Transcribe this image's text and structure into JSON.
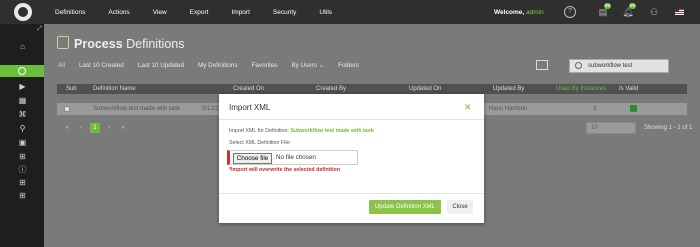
{
  "header": {
    "menu": [
      "Definitions",
      "Actions",
      "View",
      "Export",
      "Import",
      "Security",
      "Utils"
    ],
    "welcome_prefix": "Welcome,",
    "username": "admin",
    "notif_badge_1": "99",
    "notif_badge_2": "99"
  },
  "sidebar": {
    "icons": [
      "expand-icon",
      "home-icon",
      "process-icon",
      "play-icon",
      "chart-icon",
      "tag-icon",
      "search-icon",
      "dashboard-icon",
      "help-icon",
      "grid-icon",
      "apps-icon"
    ]
  },
  "page": {
    "title_bold": "Process",
    "title_rest": " Definitions",
    "tabs": [
      "All",
      "Last 10 Created",
      "Last 10 Updated",
      "My Definitions",
      "Favorites",
      "By Users ⌄",
      "Folders"
    ],
    "search_value": "subworkflow test"
  },
  "table": {
    "headers": [
      "Sub",
      "Definition Name",
      "Created On",
      "Created By",
      "Updated On",
      "Updated By",
      "Used By Instances",
      "Is Valid"
    ],
    "row": {
      "name": "Subworkflow test made with task",
      "created_on": "5/12/2",
      "updated_by": "Hans Harrison",
      "instances": "3"
    }
  },
  "pager": {
    "pages": [
      "«",
      "‹",
      "1",
      "›",
      "»"
    ],
    "per_page": "10",
    "showing": "Showing 1 - 1 of 1"
  },
  "modal": {
    "title": "Import XML",
    "close_symbol": "✕",
    "for_label": "Import XML for Definition:",
    "definition_name": "Subworkflow test made with task",
    "file_label": "Select XML Definition File:",
    "choose_button": "Choose file",
    "no_file": "No file chosen",
    "warning": "*Import will overwrite the selected definition",
    "update_button": "Update Definition XML",
    "close_button": "Close"
  },
  "colors": {
    "accent": "#8bc34a",
    "error": "#d32f2f"
  }
}
